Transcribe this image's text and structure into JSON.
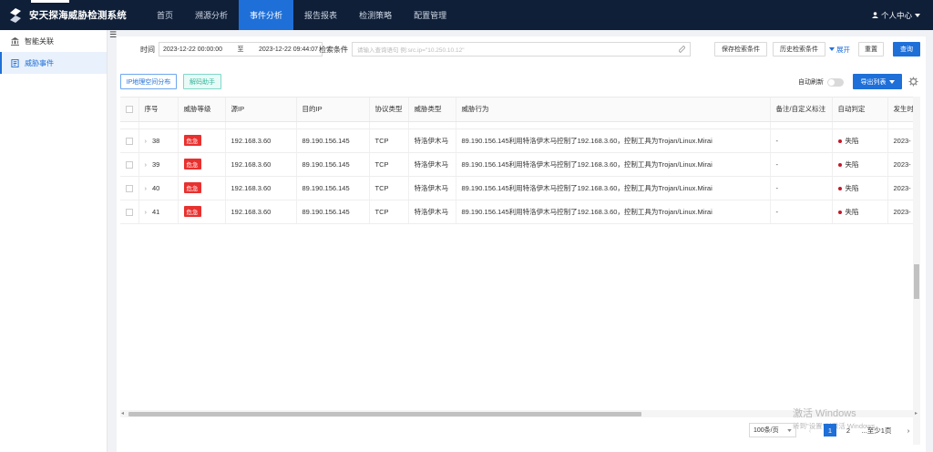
{
  "app": {
    "title": "安天探海威胁检测系统"
  },
  "nav": [
    {
      "label": "首页"
    },
    {
      "label": "溯源分析"
    },
    {
      "label": "事件分析"
    },
    {
      "label": "报告报表"
    },
    {
      "label": "检测策略"
    },
    {
      "label": "配置管理"
    }
  ],
  "user": {
    "label": "个人中心"
  },
  "sidebar": {
    "items": [
      {
        "label": "智能关联"
      },
      {
        "label": "威胁事件"
      }
    ]
  },
  "filter": {
    "time_label": "时间",
    "start": "2023-12-22 00:00:00",
    "sep": "至",
    "end": "2023-12-22 09:44:07",
    "query_label": "检索条件",
    "query_placeholder": "请输入查询语句 例:src.ip=\"10.250.10.12\"",
    "save_btn": "保存检索条件",
    "history_btn": "历史检索条件",
    "expand_link": "展开",
    "reset_btn": "重置",
    "search_btn": "查询"
  },
  "toolbar": {
    "ip_btn": "IP地理空间分布",
    "decode_btn": "解码助手",
    "auto_refresh": "自动刷新",
    "export_btn": "导出列表"
  },
  "table": {
    "headers": [
      "序号",
      "威胁等级",
      "源IP",
      "目的IP",
      "协议类型",
      "威胁类型",
      "威胁行为",
      "备注/自定义标注",
      "自动判定",
      "发生时间"
    ],
    "rows": [
      {
        "no": "38",
        "level": "危急",
        "src": "192.168.3.60",
        "dst": "89.190.156.145",
        "proto": "TCP",
        "type": "特洛伊木马",
        "behavior": "89.190.156.145利用特洛伊木马控制了192.168.3.60，控制工具为Trojan/Linux.Mirai",
        "note": "-",
        "judge": "失陷",
        "time": "2023-"
      },
      {
        "no": "39",
        "level": "危急",
        "src": "192.168.3.60",
        "dst": "89.190.156.145",
        "proto": "TCP",
        "type": "特洛伊木马",
        "behavior": "89.190.156.145利用特洛伊木马控制了192.168.3.60，控制工具为Trojan/Linux.Mirai",
        "note": "-",
        "judge": "失陷",
        "time": "2023-"
      },
      {
        "no": "40",
        "level": "危急",
        "src": "192.168.3.60",
        "dst": "89.190.156.145",
        "proto": "TCP",
        "type": "特洛伊木马",
        "behavior": "89.190.156.145利用特洛伊木马控制了192.168.3.60，控制工具为Trojan/Linux.Mirai",
        "note": "-",
        "judge": "失陷",
        "time": "2023-"
      },
      {
        "no": "41",
        "level": "危急",
        "src": "192.168.3.60",
        "dst": "89.190.156.145",
        "proto": "TCP",
        "type": "特洛伊木马",
        "behavior": "89.190.156.145利用特洛伊木马控制了192.168.3.60，控制工具为Trojan/Linux.Mirai",
        "note": "-",
        "judge": "失陷",
        "time": "2023-"
      }
    ]
  },
  "pager": {
    "size": "100条/页",
    "page1": "1",
    "page2": "2",
    "more": "...至少1页"
  },
  "watermark": {
    "line1": "激活 Windows",
    "line2": "转到\"设置\"以激活 Windows。"
  },
  "colors": {
    "nav_bg": "#0f1f38",
    "accent": "#1f6fd8",
    "critical": "#e8312f",
    "compromised": "#c4182a"
  }
}
